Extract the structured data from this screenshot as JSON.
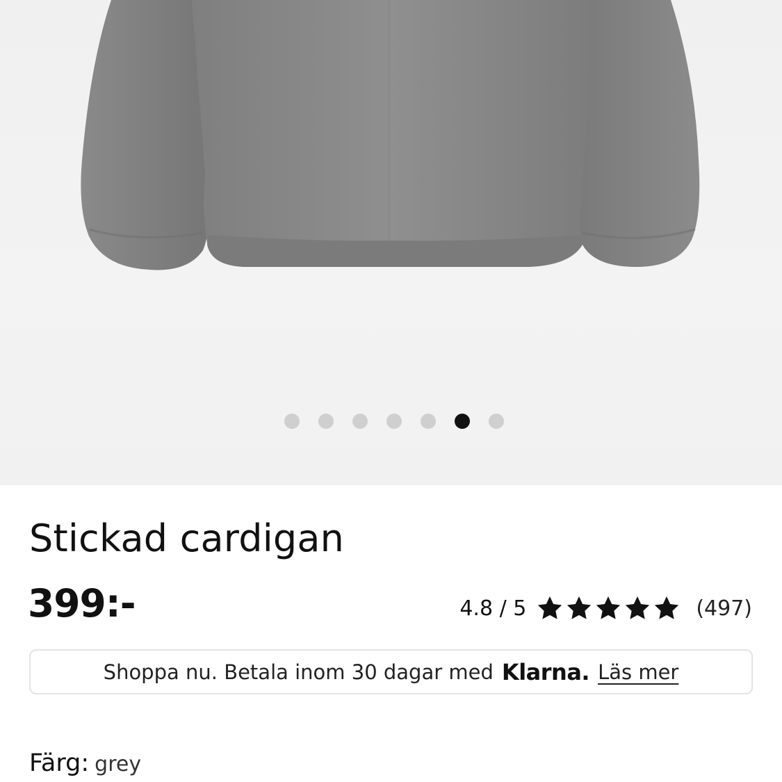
{
  "gallery": {
    "image_alt": "grey knitted cardigan",
    "dot_count": 7,
    "active_index": 5
  },
  "product": {
    "title": "Stickad cardigan",
    "price": "399:-"
  },
  "rating": {
    "score": "4.8 / 5",
    "stars": 5,
    "count": "(497)"
  },
  "klarna": {
    "text": "Shoppa nu. Betala inom 30 dagar med",
    "brand": "Klarna.",
    "link": "Läs mer"
  },
  "color": {
    "label": "Färg:",
    "value": "grey"
  },
  "icons": {
    "star": "star-icon"
  },
  "colors": {
    "garment": "#8a8a8a",
    "background": "#f2f2f2",
    "dot_active": "#111111",
    "dot_inactive": "#cfcfcf"
  }
}
